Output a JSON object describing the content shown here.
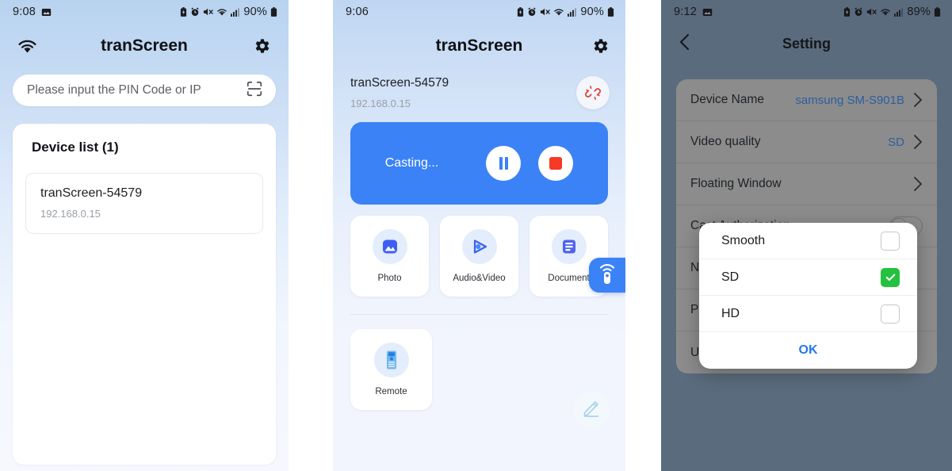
{
  "panel1": {
    "status": {
      "time": "9:08",
      "battery_pct": "90%",
      "icons": [
        "image-icon",
        "battery-saver-icon",
        "alarm-icon",
        "mute-icon",
        "wifi-icon",
        "signal-icon",
        "battery-icon"
      ]
    },
    "appbar": {
      "title": "tranScreen",
      "wifi_icon": "wifi-icon",
      "settings_icon": "gear-icon"
    },
    "search": {
      "placeholder": "Please input the PIN Code or IP",
      "value": "",
      "scan_icon": "scan-frame-icon"
    },
    "device_list": {
      "title": "Device list (1)",
      "items": [
        {
          "name": "tranScreen-54579",
          "ip": "192.168.0.15"
        }
      ]
    }
  },
  "panel2": {
    "status": {
      "time": "9:06",
      "battery_pct": "90%"
    },
    "appbar": {
      "title": "tranScreen",
      "settings_icon": "gear-icon"
    },
    "connection": {
      "name": "tranScreen-54579",
      "ip": "192.168.0.15",
      "disconnect_icon": "broken-link-icon"
    },
    "cast": {
      "label": "Casting...",
      "pause_icon": "pause-icon",
      "stop_icon": "stop-icon",
      "accent": "#3b82f6"
    },
    "features": [
      {
        "label": "Photo",
        "icon": "photo-icon"
      },
      {
        "label": "Audio&Video",
        "icon": "play-icon"
      },
      {
        "label": "Document",
        "icon": "document-icon"
      }
    ],
    "features_row2": [
      {
        "label": "Remote",
        "icon": "remote-control-icon"
      }
    ],
    "remote_tab": {
      "icon": "wifi-remote-icon"
    },
    "edit_fab": {
      "icon": "pencil-icon"
    }
  },
  "panel3": {
    "status": {
      "time": "9:12",
      "battery_pct": "89%"
    },
    "appbar": {
      "title": "Setting",
      "back_icon": "chevron-left-icon"
    },
    "settings": [
      {
        "label": "Device Name",
        "value": "samsung SM-S901B",
        "control": "chevron"
      },
      {
        "label": "Video quality",
        "value": "SD",
        "control": "chevron"
      },
      {
        "label": "Floating Window",
        "value": "",
        "control": "chevron"
      },
      {
        "label": "Cast Authorization",
        "value": "",
        "control": "toggle-off"
      },
      {
        "label": "N",
        "value": "",
        "control": "none"
      },
      {
        "label": "P",
        "value": "",
        "control": "none"
      },
      {
        "label": "U",
        "value": "",
        "control": "none"
      }
    ],
    "dialog": {
      "options": [
        {
          "label": "Smooth",
          "checked": false
        },
        {
          "label": "SD",
          "checked": true
        },
        {
          "label": "HD",
          "checked": false
        }
      ],
      "ok_label": "OK",
      "checked_color": "#24c13f"
    }
  }
}
